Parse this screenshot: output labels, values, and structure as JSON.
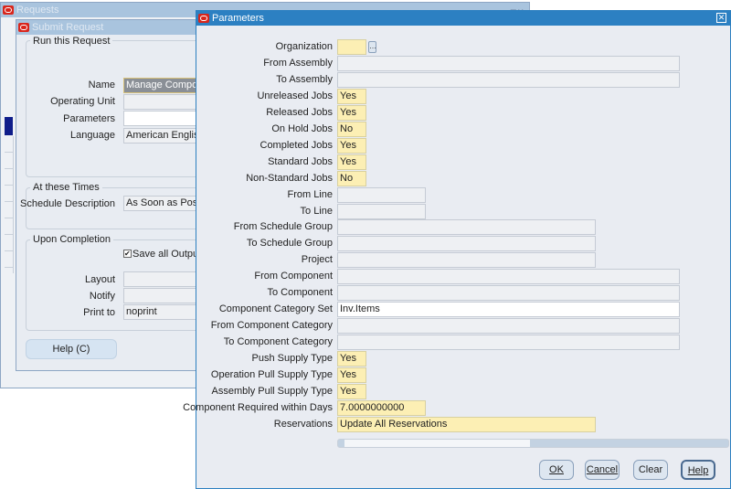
{
  "requests_window": {
    "title": "Requests"
  },
  "submit_window": {
    "title": "Submit Request",
    "run_group": "Run this Request",
    "name_label": "Name",
    "name_value": "Manage Compone",
    "ou_label": "Operating Unit",
    "ou_value": "",
    "params_label": "Parameters",
    "params_value": "",
    "lang_label": "Language",
    "lang_value": "American English",
    "times_group": "At these Times",
    "sched_label": "Schedule Description",
    "sched_value": "As Soon as Poss",
    "completion_group": "Upon Completion",
    "save_output_label": "Save all Output F",
    "save_output_checked": true,
    "layout_label": "Layout",
    "layout_value": "",
    "notify_label": "Notify",
    "notify_value": "",
    "print_label": "Print to",
    "print_value": "noprint",
    "help_button": "Help (C)"
  },
  "parameters_window": {
    "title": "Parameters",
    "fields": [
      {
        "label": "Organization",
        "value": ""
      },
      {
        "label": "From Assembly",
        "value": ""
      },
      {
        "label": "To Assembly",
        "value": ""
      },
      {
        "label": "Unreleased Jobs",
        "value": "Yes"
      },
      {
        "label": "Released Jobs",
        "value": "Yes"
      },
      {
        "label": "On Hold Jobs",
        "value": "No"
      },
      {
        "label": "Completed Jobs",
        "value": "Yes"
      },
      {
        "label": "Standard Jobs",
        "value": "Yes"
      },
      {
        "label": "Non-Standard Jobs",
        "value": "No"
      },
      {
        "label": "From Line",
        "value": ""
      },
      {
        "label": "To Line",
        "value": ""
      },
      {
        "label": "From Schedule Group",
        "value": ""
      },
      {
        "label": "To Schedule Group",
        "value": ""
      },
      {
        "label": "Project",
        "value": ""
      },
      {
        "label": "From Component",
        "value": ""
      },
      {
        "label": "To Component",
        "value": ""
      },
      {
        "label": "Component Category Set",
        "value": "Inv.Items"
      },
      {
        "label": "From Component Category",
        "value": ""
      },
      {
        "label": "To Component Category",
        "value": ""
      },
      {
        "label": "Push Supply Type",
        "value": "Yes"
      },
      {
        "label": "Operation Pull Supply Type",
        "value": "Yes"
      },
      {
        "label": "Assembly Pull Supply Type",
        "value": "Yes"
      },
      {
        "label": "Component Required within Days",
        "value": "7.0000000000"
      },
      {
        "label": "Reservations",
        "value": "Update All Reservations"
      }
    ],
    "buttons": {
      "ok": "OK",
      "cancel": "Cancel",
      "clear": "Clear",
      "help": "Help"
    }
  }
}
